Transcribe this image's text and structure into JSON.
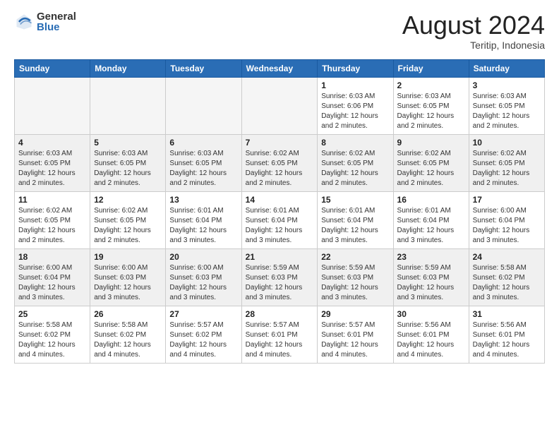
{
  "header": {
    "logo_general": "General",
    "logo_blue": "Blue",
    "month_year": "August 2024",
    "location": "Teritip, Indonesia"
  },
  "days_of_week": [
    "Sunday",
    "Monday",
    "Tuesday",
    "Wednesday",
    "Thursday",
    "Friday",
    "Saturday"
  ],
  "weeks": [
    {
      "days": [
        {
          "num": "",
          "info": ""
        },
        {
          "num": "",
          "info": ""
        },
        {
          "num": "",
          "info": ""
        },
        {
          "num": "",
          "info": ""
        },
        {
          "num": "1",
          "info": "Sunrise: 6:03 AM\nSunset: 6:06 PM\nDaylight: 12 hours\nand 2 minutes."
        },
        {
          "num": "2",
          "info": "Sunrise: 6:03 AM\nSunset: 6:05 PM\nDaylight: 12 hours\nand 2 minutes."
        },
        {
          "num": "3",
          "info": "Sunrise: 6:03 AM\nSunset: 6:05 PM\nDaylight: 12 hours\nand 2 minutes."
        }
      ]
    },
    {
      "days": [
        {
          "num": "4",
          "info": "Sunrise: 6:03 AM\nSunset: 6:05 PM\nDaylight: 12 hours\nand 2 minutes."
        },
        {
          "num": "5",
          "info": "Sunrise: 6:03 AM\nSunset: 6:05 PM\nDaylight: 12 hours\nand 2 minutes."
        },
        {
          "num": "6",
          "info": "Sunrise: 6:03 AM\nSunset: 6:05 PM\nDaylight: 12 hours\nand 2 minutes."
        },
        {
          "num": "7",
          "info": "Sunrise: 6:02 AM\nSunset: 6:05 PM\nDaylight: 12 hours\nand 2 minutes."
        },
        {
          "num": "8",
          "info": "Sunrise: 6:02 AM\nSunset: 6:05 PM\nDaylight: 12 hours\nand 2 minutes."
        },
        {
          "num": "9",
          "info": "Sunrise: 6:02 AM\nSunset: 6:05 PM\nDaylight: 12 hours\nand 2 minutes."
        },
        {
          "num": "10",
          "info": "Sunrise: 6:02 AM\nSunset: 6:05 PM\nDaylight: 12 hours\nand 2 minutes."
        }
      ]
    },
    {
      "days": [
        {
          "num": "11",
          "info": "Sunrise: 6:02 AM\nSunset: 6:05 PM\nDaylight: 12 hours\nand 2 minutes."
        },
        {
          "num": "12",
          "info": "Sunrise: 6:02 AM\nSunset: 6:05 PM\nDaylight: 12 hours\nand 2 minutes."
        },
        {
          "num": "13",
          "info": "Sunrise: 6:01 AM\nSunset: 6:04 PM\nDaylight: 12 hours\nand 3 minutes."
        },
        {
          "num": "14",
          "info": "Sunrise: 6:01 AM\nSunset: 6:04 PM\nDaylight: 12 hours\nand 3 minutes."
        },
        {
          "num": "15",
          "info": "Sunrise: 6:01 AM\nSunset: 6:04 PM\nDaylight: 12 hours\nand 3 minutes."
        },
        {
          "num": "16",
          "info": "Sunrise: 6:01 AM\nSunset: 6:04 PM\nDaylight: 12 hours\nand 3 minutes."
        },
        {
          "num": "17",
          "info": "Sunrise: 6:00 AM\nSunset: 6:04 PM\nDaylight: 12 hours\nand 3 minutes."
        }
      ]
    },
    {
      "days": [
        {
          "num": "18",
          "info": "Sunrise: 6:00 AM\nSunset: 6:04 PM\nDaylight: 12 hours\nand 3 minutes."
        },
        {
          "num": "19",
          "info": "Sunrise: 6:00 AM\nSunset: 6:03 PM\nDaylight: 12 hours\nand 3 minutes."
        },
        {
          "num": "20",
          "info": "Sunrise: 6:00 AM\nSunset: 6:03 PM\nDaylight: 12 hours\nand 3 minutes."
        },
        {
          "num": "21",
          "info": "Sunrise: 5:59 AM\nSunset: 6:03 PM\nDaylight: 12 hours\nand 3 minutes."
        },
        {
          "num": "22",
          "info": "Sunrise: 5:59 AM\nSunset: 6:03 PM\nDaylight: 12 hours\nand 3 minutes."
        },
        {
          "num": "23",
          "info": "Sunrise: 5:59 AM\nSunset: 6:03 PM\nDaylight: 12 hours\nand 3 minutes."
        },
        {
          "num": "24",
          "info": "Sunrise: 5:58 AM\nSunset: 6:02 PM\nDaylight: 12 hours\nand 3 minutes."
        }
      ]
    },
    {
      "days": [
        {
          "num": "25",
          "info": "Sunrise: 5:58 AM\nSunset: 6:02 PM\nDaylight: 12 hours\nand 4 minutes."
        },
        {
          "num": "26",
          "info": "Sunrise: 5:58 AM\nSunset: 6:02 PM\nDaylight: 12 hours\nand 4 minutes."
        },
        {
          "num": "27",
          "info": "Sunrise: 5:57 AM\nSunset: 6:02 PM\nDaylight: 12 hours\nand 4 minutes."
        },
        {
          "num": "28",
          "info": "Sunrise: 5:57 AM\nSunset: 6:01 PM\nDaylight: 12 hours\nand 4 minutes."
        },
        {
          "num": "29",
          "info": "Sunrise: 5:57 AM\nSunset: 6:01 PM\nDaylight: 12 hours\nand 4 minutes."
        },
        {
          "num": "30",
          "info": "Sunrise: 5:56 AM\nSunset: 6:01 PM\nDaylight: 12 hours\nand 4 minutes."
        },
        {
          "num": "31",
          "info": "Sunrise: 5:56 AM\nSunset: 6:01 PM\nDaylight: 12 hours\nand 4 minutes."
        }
      ]
    }
  ]
}
